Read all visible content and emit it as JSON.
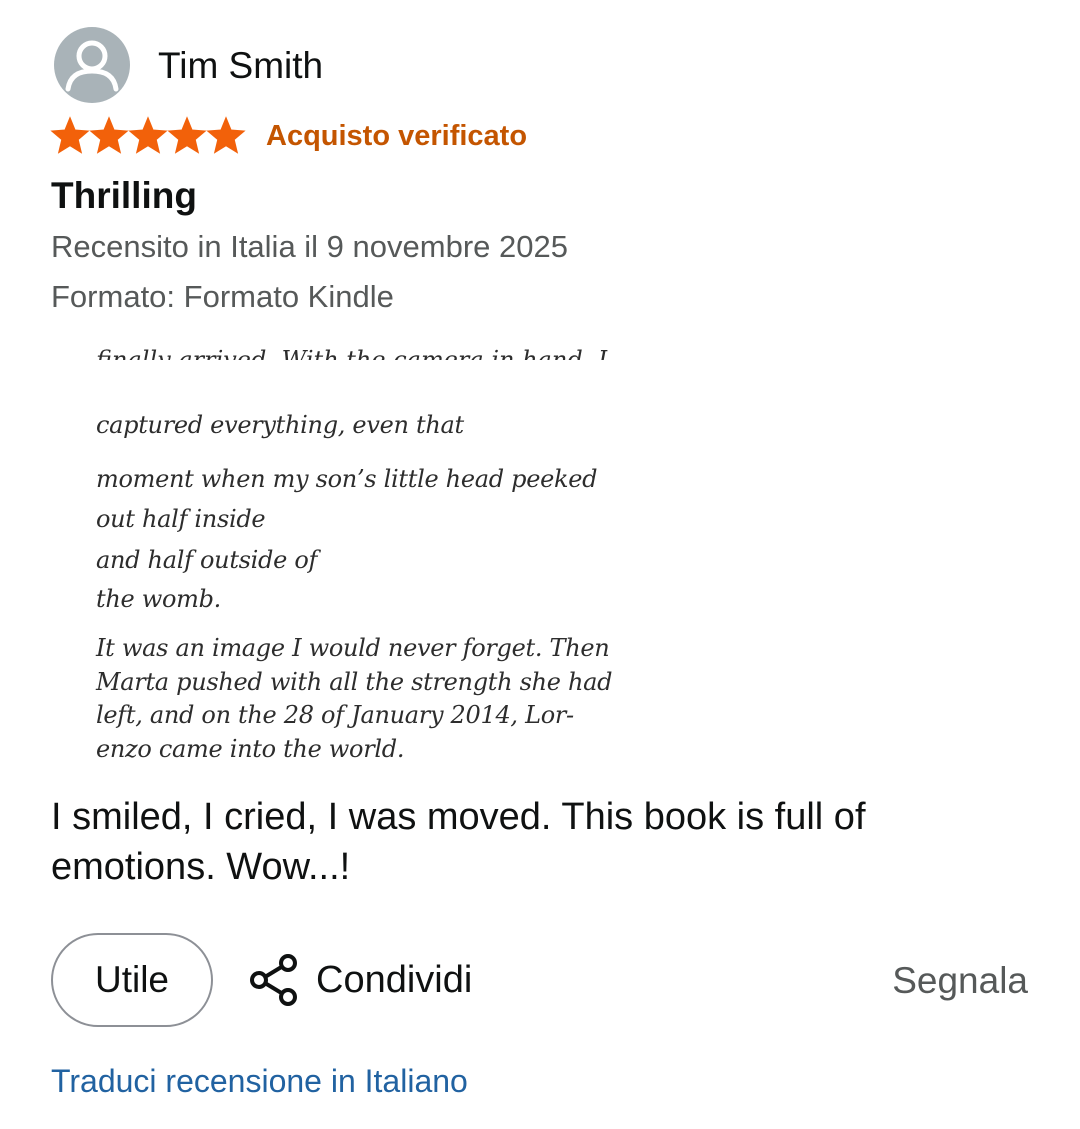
{
  "review": {
    "reviewer": {
      "name": "Tim Smith",
      "avatar_icon": "person-silhouette-icon"
    },
    "rating": {
      "stars": 5,
      "max_stars": 5,
      "star_color": "#f2610a"
    },
    "verified_label": "Acquisto verificato",
    "title": "Thrilling",
    "date_text": "Recensito in Italia il 9 novembre 2025",
    "format_text": "Formato: Formato Kindle",
    "excerpt": {
      "clipped_top_line": "finally arrived. With the camera in hand, I",
      "lines": [
        "captured everything, even that",
        "moment when my son’s little head peeked",
        "out half inside",
        "and half outside of",
        "the womb.",
        "It was an image I would never forget. Then",
        "Marta pushed with all the strength she had",
        "left, and on the 28 of January 2014, Lor-",
        "enzo came into the world."
      ]
    },
    "body": "I smiled, I cried, I was moved. This book is full of emotions. Wow...!"
  },
  "actions": {
    "helpful_label": "Utile",
    "share_label": "Condividi",
    "share_icon": "share-icon",
    "report_label": "Segnala",
    "translate_label": "Traduci recensione in Italiano"
  },
  "colors": {
    "verified": "#c45500",
    "link": "#2162a1",
    "secondary_text": "#565959",
    "avatar_bg": "#a9b3b8"
  }
}
